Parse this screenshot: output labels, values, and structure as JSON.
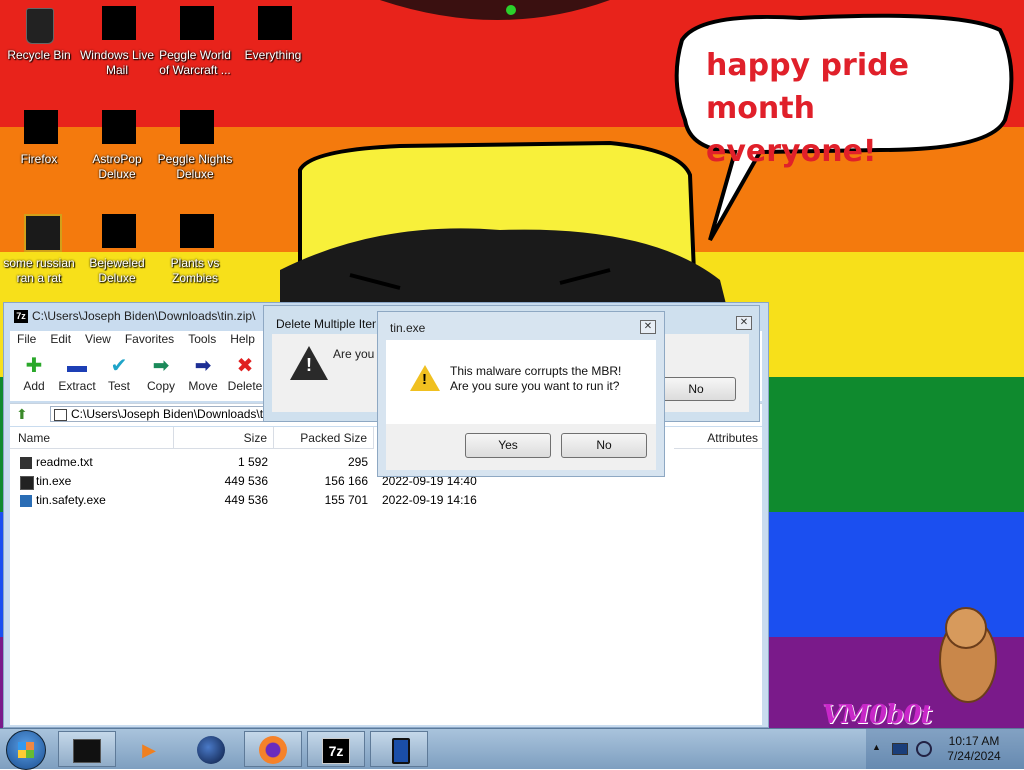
{
  "desktop": {
    "icons": [
      {
        "label": "Recycle Bin"
      },
      {
        "label": "Windows Live Mail"
      },
      {
        "label": "Peggle World of Warcraft ..."
      },
      {
        "label": "Everything"
      },
      {
        "label": "Firefox"
      },
      {
        "label": "AstroPop Deluxe"
      },
      {
        "label": "Peggle Nights Deluxe"
      },
      {
        "label": "some russian ran a rat"
      },
      {
        "label": "Bejeweled Deluxe"
      },
      {
        "label": "Plants vs Zombies"
      }
    ],
    "bubble_line1": "happy pride month",
    "bubble_line2": "everyone!",
    "watermark": "VM0b0t",
    "colors": {
      "red": "#e8231b",
      "orange": "#f47a0d",
      "yellow": "#f7e01a",
      "green": "#0f8a2e",
      "blue": "#1b4ff0",
      "purple": "#7a1a8a"
    }
  },
  "zip_window": {
    "title": "C:\\Users\\Joseph Biden\\Downloads\\tin.zip\\",
    "app_icon": "7z",
    "menu": [
      "File",
      "Edit",
      "View",
      "Favorites",
      "Tools",
      "Help"
    ],
    "toolbar": [
      {
        "label": "Add",
        "icon": "plus-icon"
      },
      {
        "label": "Extract",
        "icon": "minus-icon"
      },
      {
        "label": "Test",
        "icon": "check-icon"
      },
      {
        "label": "Copy",
        "icon": "copy-arrow-icon"
      },
      {
        "label": "Move",
        "icon": "move-arrow-icon"
      },
      {
        "label": "Delete",
        "icon": "delete-x-icon"
      }
    ],
    "address": "C:\\Users\\Joseph Biden\\Downloads\\tin.zip\\",
    "columns": {
      "name": "Name",
      "size": "Size",
      "packed": "Packed Size",
      "attributes": "Attributes"
    },
    "files": [
      {
        "name": "readme.txt",
        "size": "1 592",
        "packed": "295",
        "modified": ""
      },
      {
        "name": "tin.exe",
        "size": "449 536",
        "packed": "156 166",
        "modified": "2022-09-19 14:40"
      },
      {
        "name": "tin.safety.exe",
        "size": "449 536",
        "packed": "155 701",
        "modified": "2022-09-19 14:16"
      }
    ]
  },
  "delete_dialog": {
    "title": "Delete Multiple Items",
    "text": "Are you",
    "no_label": "No"
  },
  "msgbox": {
    "title": "tin.exe",
    "line1": "This malware corrupts the MBR!",
    "line2": "Are you sure you want to run it?",
    "yes_label": "Yes",
    "no_label": "No"
  },
  "taskbar": {
    "app_7z": "7z",
    "time": "10:17 AM",
    "date": "7/24/2024"
  }
}
